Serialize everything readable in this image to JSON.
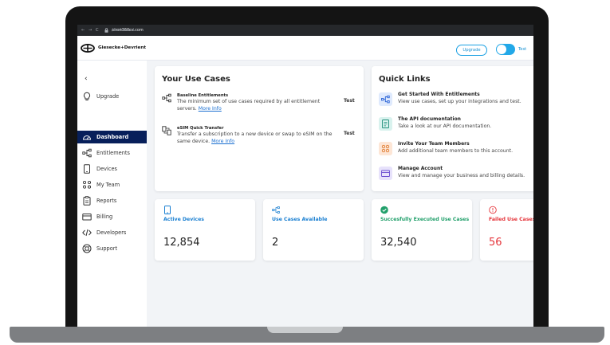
{
  "browser": {
    "back": "←",
    "forward": "→",
    "reload": "C",
    "domain": "airon360cs.com",
    "path": "/dashboard"
  },
  "header": {
    "brand": "Giesecke+Devrient",
    "upgrade_label": "Upgrade",
    "toggle_label": "Test"
  },
  "sidebar": {
    "collapse": "‹",
    "items": [
      {
        "label": "Upgrade",
        "icon": "lightbulb-icon"
      },
      {
        "label": "Dashboard",
        "icon": "gauge-icon",
        "active": true
      },
      {
        "label": "Entitlements",
        "icon": "connection-icon"
      },
      {
        "label": "Devices",
        "icon": "device-icon"
      },
      {
        "label": "My Team",
        "icon": "team-icon"
      },
      {
        "label": "Reports",
        "icon": "report-icon"
      },
      {
        "label": "Billing",
        "icon": "billing-icon"
      },
      {
        "label": "Developers",
        "icon": "code-icon"
      },
      {
        "label": "Support",
        "icon": "support-icon"
      }
    ]
  },
  "use_cases": {
    "title": "Your Use Cases",
    "items": [
      {
        "name": "Baseline Entitlements",
        "desc": "The minimum set of use cases required by all entitlement servers.",
        "link": "More Info",
        "action": "Test"
      },
      {
        "name": "eSIM Quick Transfer",
        "desc": "Transfer a subscription to a new device or swap to eSIM on the same device.",
        "link": "More Info",
        "action": "Test"
      }
    ]
  },
  "quick_links": {
    "title": "Quick Links",
    "items": [
      {
        "title": "Get Started With Entitlements",
        "desc": "View use cases, set up your integrations and test.",
        "icon": "connection-icon"
      },
      {
        "title": "The API documentation",
        "desc": "Take a look at our API documentation.",
        "icon": "document-icon"
      },
      {
        "title": "Invite Your Team Members",
        "desc": "Add additional team members to this account.",
        "icon": "team-icon"
      },
      {
        "title": "Manage Account",
        "desc": "View and manage your business and billing details.",
        "icon": "billing-icon"
      }
    ]
  },
  "stats": [
    {
      "label": "Active Devices",
      "value": "12,854",
      "icon": "device-icon"
    },
    {
      "label": "Use Cases Available",
      "value": "2",
      "icon": "connection-icon"
    },
    {
      "label": "Succesfully Executed Use Cases",
      "value": "32,540",
      "icon": "check-circle-icon"
    },
    {
      "label": "Failed Use Cases",
      "value": "56",
      "icon": "alert-circle-icon"
    }
  ],
  "colors": {
    "primary_nav": "#071f5a",
    "accent_blue": "#1a7fd1",
    "success_green": "#22a06b",
    "error_red": "#e5343a",
    "toggle": "#22a8e8"
  }
}
